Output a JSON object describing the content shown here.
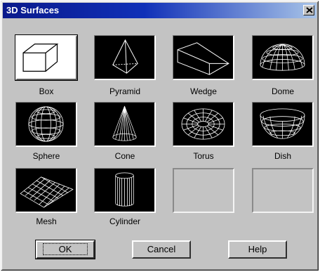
{
  "window": {
    "title": "3D Surfaces",
    "close_glyph": "×"
  },
  "shapes": {
    "box": "Box",
    "pyramid": "Pyramid",
    "wedge": "Wedge",
    "dome": "Dome",
    "sphere": "Sphere",
    "cone": "Cone",
    "torus": "Torus",
    "dish": "Dish",
    "mesh": "Mesh",
    "cylinder": "Cylinder"
  },
  "selected_shape": "Box",
  "buttons": {
    "ok": "OK",
    "cancel": "Cancel",
    "help": "Help"
  },
  "colors": {
    "title_start": "#0a1a8c",
    "title_end": "#a8c4e8",
    "dialog": "#c3c3c3",
    "tile": "#000000"
  }
}
